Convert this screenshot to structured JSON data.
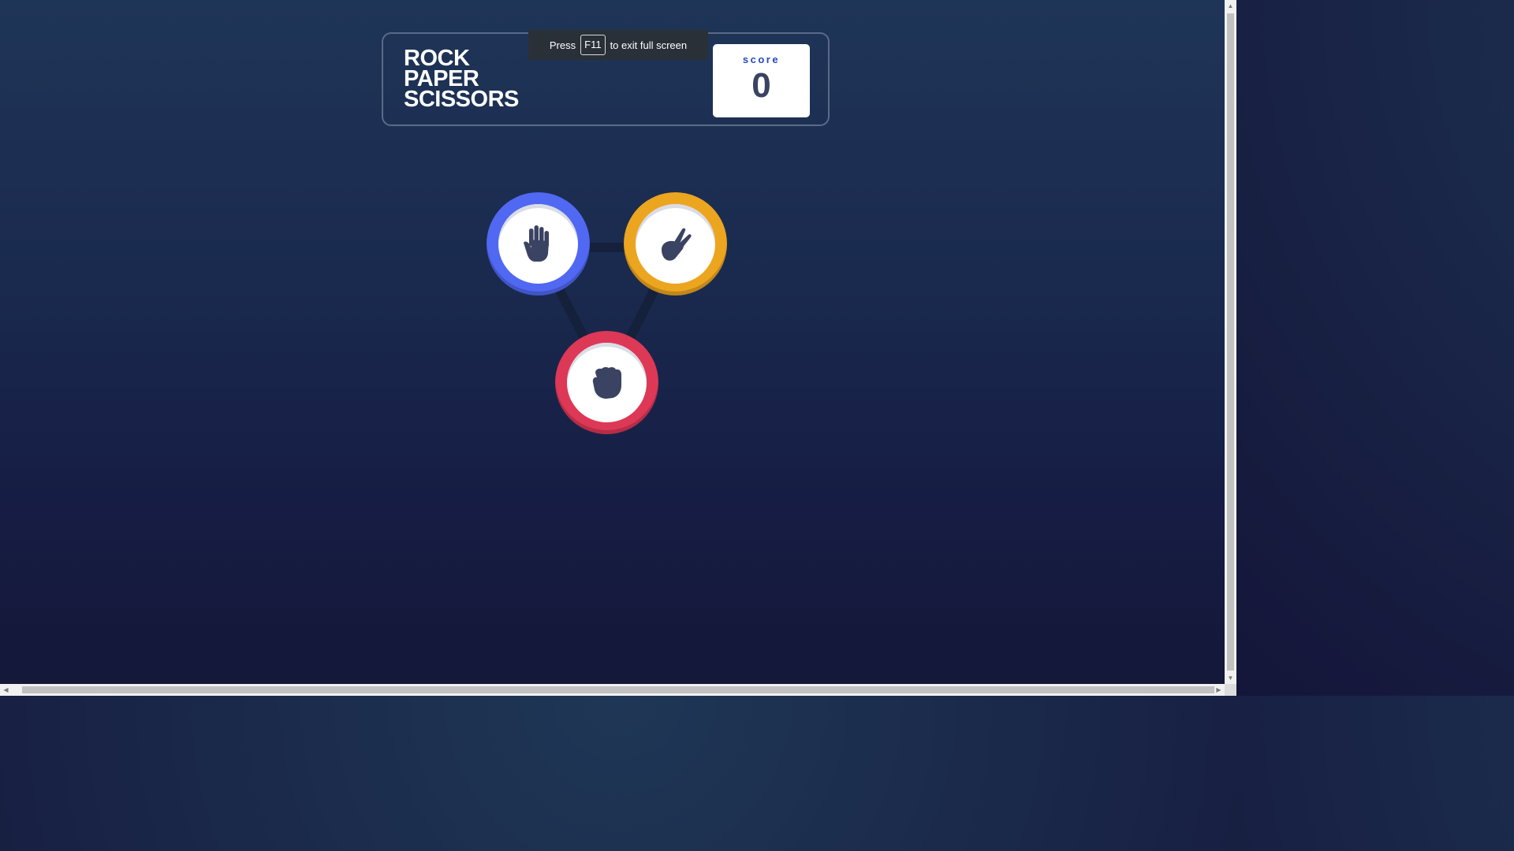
{
  "header": {
    "title_lines": [
      "ROCK",
      "PAPER",
      "SCISSORS"
    ],
    "score_label": "score",
    "score_value": "0"
  },
  "fullscreen_toast": {
    "press": "Press",
    "key": "F11",
    "suffix": "to exit full screen"
  },
  "game": {
    "tokens": [
      {
        "name": "paper",
        "icon": "paper-hand-icon",
        "color": "#5068f2"
      },
      {
        "name": "scissors",
        "icon": "scissors-hand-icon",
        "color": "#eca51f"
      },
      {
        "name": "rock",
        "icon": "rock-fist-icon",
        "color": "#dd3856"
      }
    ],
    "connector_color": "#15203a"
  },
  "scrollbars": {
    "up_arrow": "▲",
    "down_arrow": "▼",
    "left_arrow": "◀",
    "right_arrow": "▶"
  }
}
